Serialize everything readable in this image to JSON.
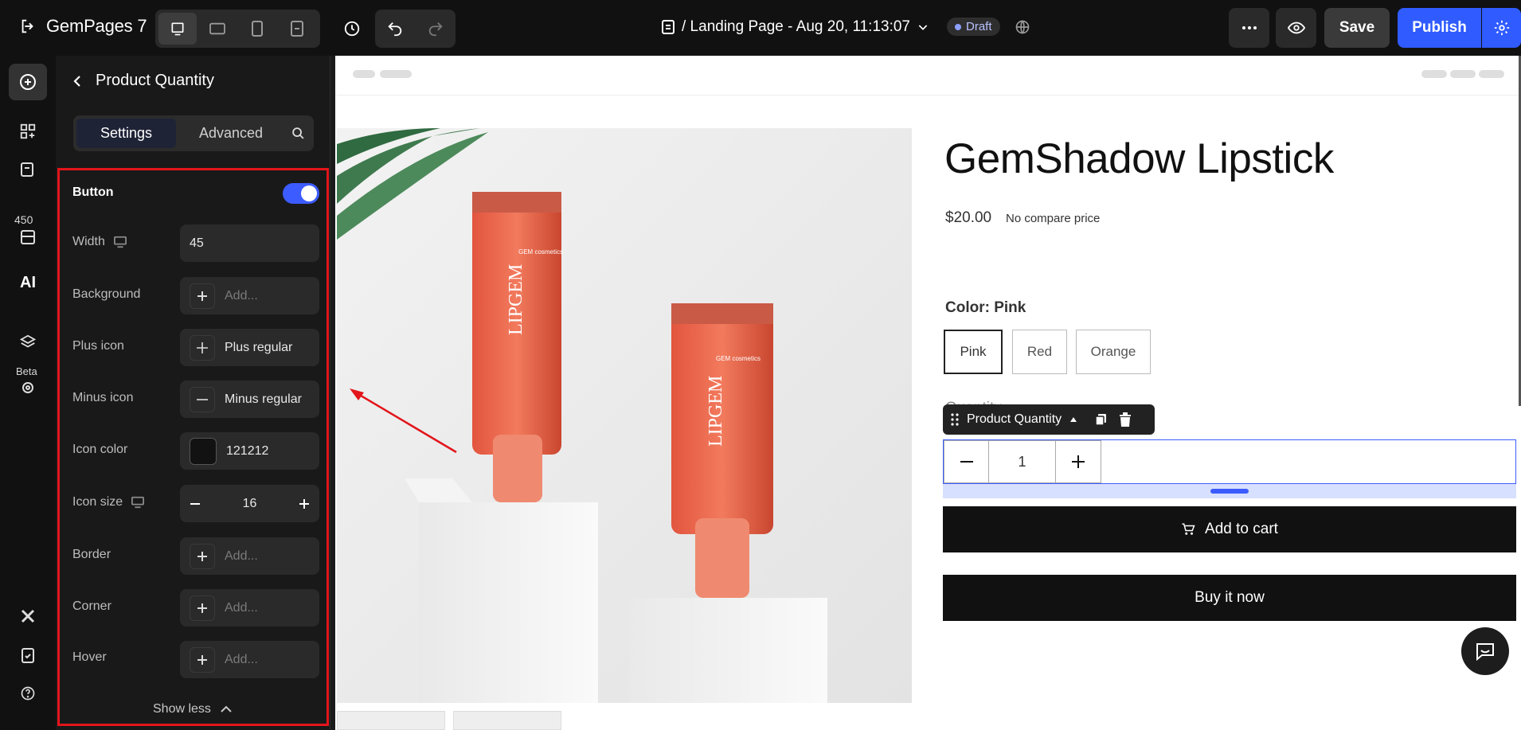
{
  "app": {
    "name": "GemPages 7"
  },
  "topbar": {
    "page_title": "/ Landing Page - Aug 20, 11:13:07",
    "status": "Draft",
    "save_label": "Save",
    "publish_label": "Publish",
    "accent": "#2f5bff"
  },
  "leftrail": {
    "badge_count": "450",
    "beta_label": "Beta",
    "ai_label": "AI"
  },
  "panel": {
    "title": "Product Quantity",
    "tabs": [
      "Settings",
      "Advanced"
    ],
    "section_title": "Button",
    "toggle_on": true,
    "rows": {
      "width": {
        "label": "Width",
        "value": "45"
      },
      "background": {
        "label": "Background",
        "placeholder": "Add..."
      },
      "plus_icon": {
        "label": "Plus icon",
        "value": "Plus regular"
      },
      "minus_icon": {
        "label": "Minus icon",
        "value": "Minus regular"
      },
      "icon_color": {
        "label": "Icon color",
        "value": "121212"
      },
      "icon_size": {
        "label": "Icon size",
        "value": "16"
      },
      "border": {
        "label": "Border",
        "placeholder": "Add..."
      },
      "corner": {
        "label": "Corner",
        "placeholder": "Add..."
      },
      "hover": {
        "label": "Hover",
        "placeholder": "Add..."
      }
    },
    "show_less": "Show less"
  },
  "product": {
    "title": "GemShadow Lipstick",
    "price": "$20.00",
    "compare": "No compare price",
    "color_label": "Color: Pink",
    "variants": [
      "Pink",
      "Red",
      "Orange"
    ],
    "quantity_label": "Quantity",
    "element_tag": "Product Quantity",
    "quantity": "1",
    "add_to_cart": "Add to cart",
    "buy_now": "Buy it now",
    "tube_brand": "LIPGEM",
    "tube_sub": "GEM cosmetics"
  }
}
